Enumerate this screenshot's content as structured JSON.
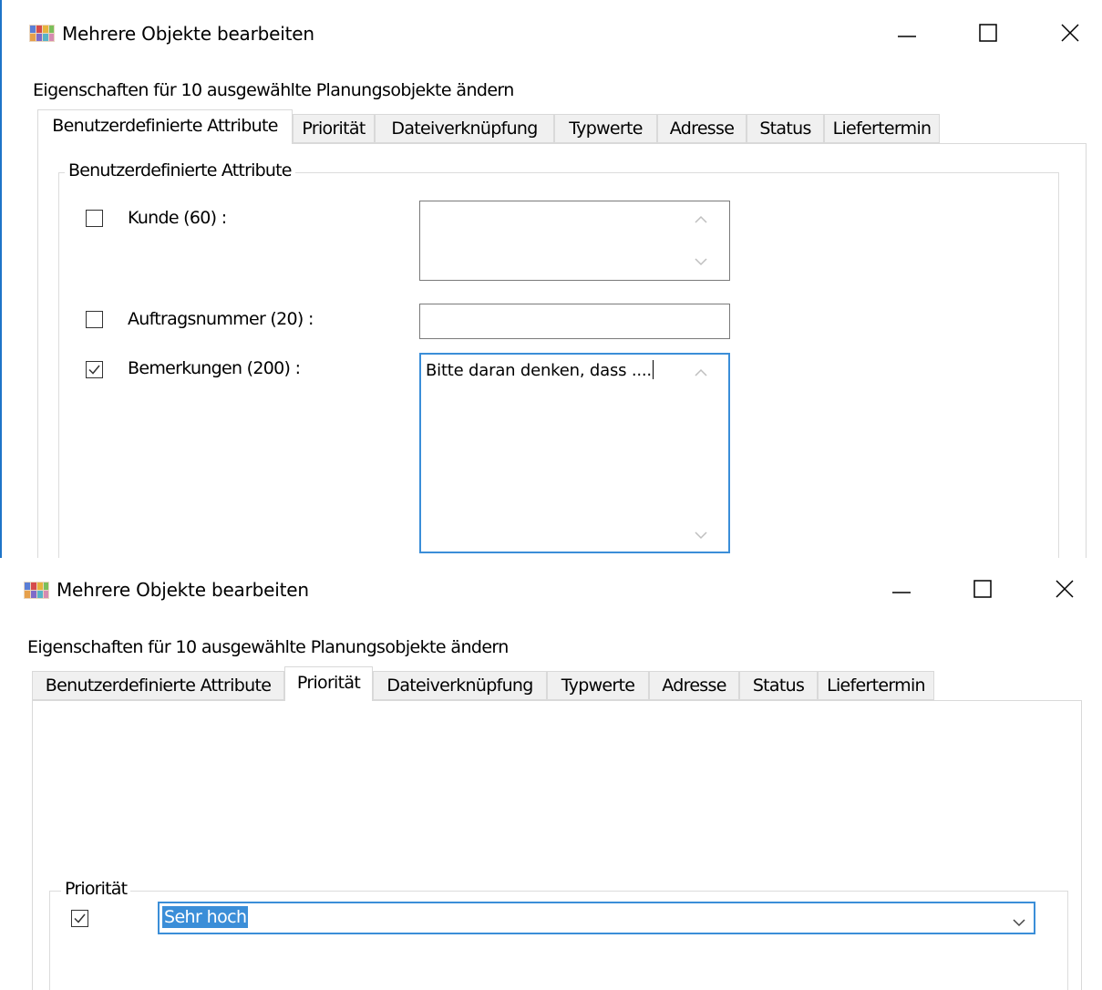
{
  "windows": [
    {
      "title": "Mehrere Objekte bearbeiten",
      "description": "Eigenschaften für 10 ausgewählte Planungsobjekte  ändern",
      "tabs": [
        "Benutzerdefinierte Attribute",
        "Priorität",
        "Dateiverknüpfung",
        "Typwerte",
        "Adresse",
        "Status",
        "Liefertermin"
      ],
      "active_tab": "Benutzerdefinierte Attribute",
      "group_label": "Benutzerdefinierte Attribute",
      "fields": [
        {
          "label": "Kunde (60) :",
          "checked": false,
          "value": ""
        },
        {
          "label": "Auftragsnummer (20) :",
          "checked": false,
          "value": ""
        },
        {
          "label": "Bemerkungen (200) :",
          "checked": true,
          "value": "Bitte daran denken, dass ...."
        }
      ]
    },
    {
      "title": "Mehrere Objekte bearbeiten",
      "description": "Eigenschaften für 10 ausgewählte Planungsobjekte  ändern",
      "tabs": [
        "Benutzerdefinierte Attribute",
        "Priorität",
        "Dateiverknüpfung",
        "Typwerte",
        "Adresse",
        "Status",
        "Liefertermin"
      ],
      "active_tab": "Priorität",
      "group_label": "Priorität",
      "priority": {
        "checked": true,
        "value": "Sehr hoch"
      }
    }
  ],
  "icons": {
    "app": "app-icon",
    "minimize": "minimize-icon",
    "maximize": "maximize-icon",
    "close": "close-icon",
    "checkmark": "checkmark-icon",
    "scroll_up": "scroll-up-icon",
    "scroll_down": "scroll-down-icon",
    "dropdown": "chevron-down-icon"
  },
  "colors": {
    "focus": "#3b8ed8",
    "selection": "#3b8ed8",
    "tab_bg": "#f0f0f0",
    "border": "#d9d9d9"
  }
}
